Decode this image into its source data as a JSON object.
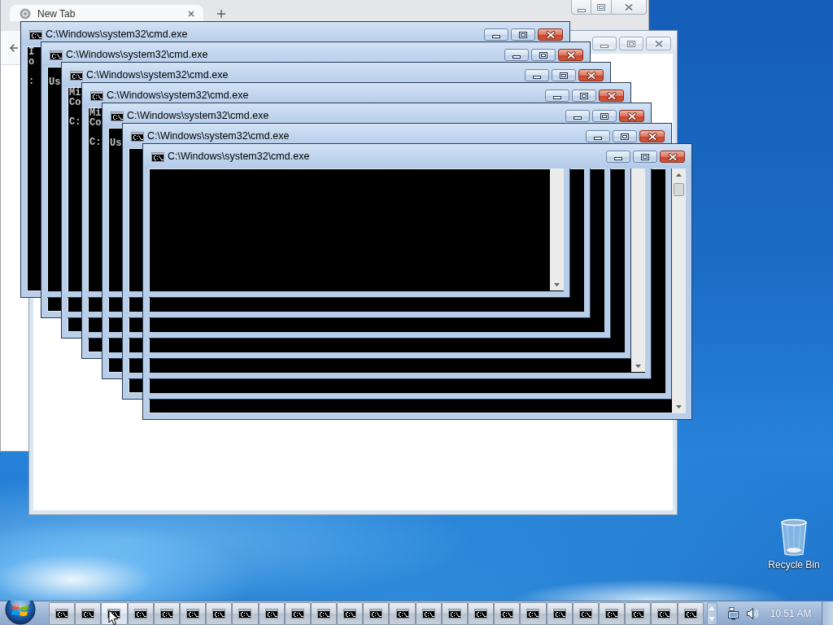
{
  "browser_window": {
    "active": false,
    "tab": {
      "title": "New Tab",
      "selected": true
    }
  },
  "background_window": {
    "active": false
  },
  "console_windows": [
    {
      "title": "C:\\Windows\\system32\\cmd.exe",
      "active": true,
      "console_text": "I\no\n\n:",
      "scrollbar": true
    },
    {
      "title": "C:\\Windows\\system32\\cmd.exe",
      "active": true,
      "console_text": "\nUs",
      "scrollbar": false
    },
    {
      "title": "C:\\Windows\\system32\\cmd.exe",
      "active": true,
      "console_text": "Mi\nCo\n\nC:",
      "scrollbar": false
    },
    {
      "title": "C:\\Windows\\system32\\cmd.exe",
      "active": true,
      "console_text": "Mi\nCo\n\nC:",
      "scrollbar": false
    },
    {
      "title": "C:\\Windows\\system32\\cmd.exe",
      "active": true,
      "console_text": "\nUs",
      "scrollbar": true
    },
    {
      "title": "C:\\Windows\\system32\\cmd.exe",
      "active": true,
      "scrollbar": false
    },
    {
      "title": "C:\\Windows\\system32\\cmd.exe",
      "active": true,
      "scrollbar": true
    }
  ],
  "desktop_icons": [
    {
      "label": "Recycle Bin"
    }
  ],
  "taskbar": {
    "buttons": [
      {
        "hovered": false
      },
      {
        "hovered": false
      },
      {
        "hovered": true
      },
      {
        "hovered": false
      },
      {
        "hovered": false
      },
      {
        "hovered": false
      },
      {
        "hovered": false
      },
      {
        "hovered": false
      },
      {
        "hovered": false
      },
      {
        "hovered": false
      },
      {
        "hovered": false
      },
      {
        "hovered": false
      },
      {
        "hovered": false
      },
      {
        "hovered": false
      },
      {
        "hovered": false
      },
      {
        "hovered": false
      },
      {
        "hovered": false
      },
      {
        "hovered": false
      },
      {
        "hovered": false
      },
      {
        "hovered": false
      },
      {
        "hovered": false
      },
      {
        "hovered": false
      },
      {
        "hovered": false
      },
      {
        "hovered": false
      },
      {
        "hovered": false
      }
    ],
    "clock": "10:51 AM"
  }
}
